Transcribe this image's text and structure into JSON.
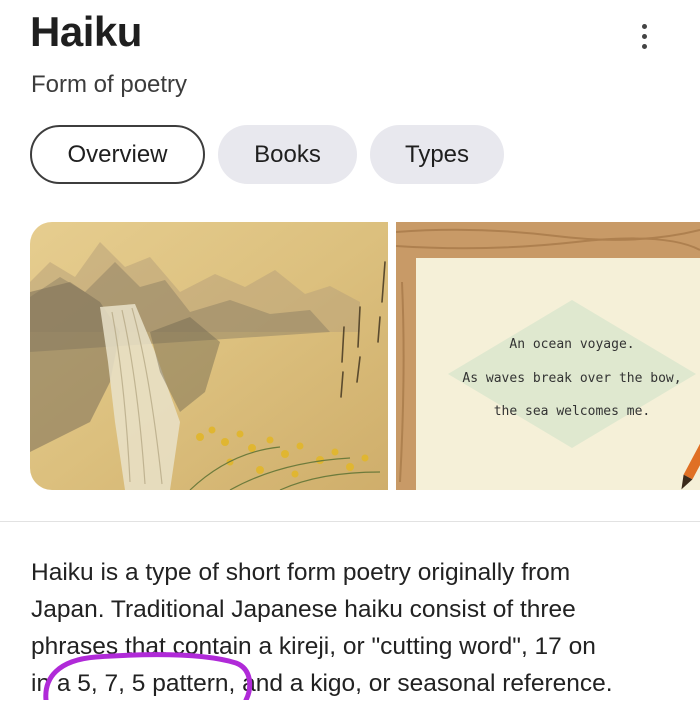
{
  "header": {
    "title": "Haiku",
    "subtitle": "Form of poetry",
    "more_icon": "more-vert-icon"
  },
  "tabs": [
    {
      "label": "Overview",
      "active": true
    },
    {
      "label": "Books",
      "active": false
    },
    {
      "label": "Types",
      "active": false
    }
  ],
  "images": {
    "first": {
      "icon": "japanese-painting-image"
    },
    "second": {
      "icon": "haiku-card-image",
      "poem": [
        "An ocean voyage.",
        "As waves break over the bow,",
        "the sea welcomes me."
      ]
    }
  },
  "description": {
    "lines": [
      "Haiku is a type of short form poetry originally from",
      "Japan. Traditional Japanese haiku consist of three",
      "phrases that contain a kireji, or \"cutting word\", 17 on",
      "in a 5, 7, 5 pattern, and a kigo, or seasonal reference."
    ]
  },
  "colors": {
    "annotation": "#b02ad8",
    "chip_bg": "#e8e8ee",
    "card_bg": "#f5f0d8",
    "diamond": "#dfe8cf",
    "wood": "#c89a67"
  }
}
